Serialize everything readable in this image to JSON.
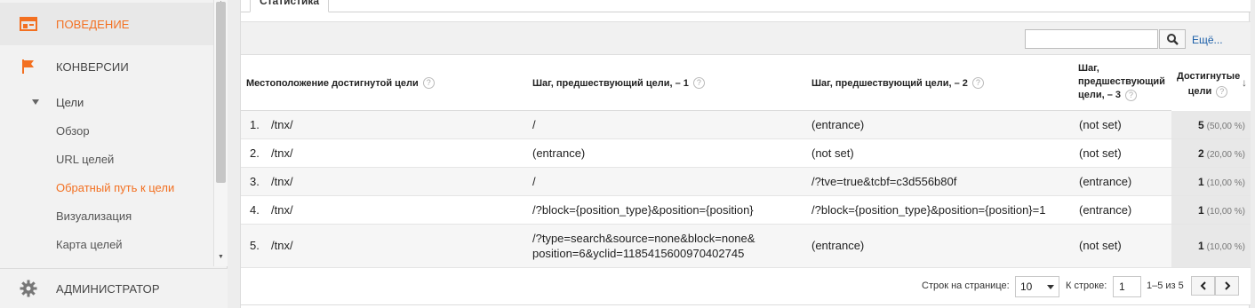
{
  "sidebar": {
    "behavior": {
      "label": "ПОВЕДЕНИЕ",
      "icon": "layout-icon"
    },
    "conversions": {
      "label": "КОНВЕРСИИ",
      "icon": "flag-icon"
    },
    "goals": {
      "label": "Цели"
    },
    "links": [
      {
        "label": "Обзор"
      },
      {
        "label": "URL целей"
      },
      {
        "label": "Обратный путь к цели"
      },
      {
        "label": "Визуализация"
      },
      {
        "label": "Карта целей"
      }
    ],
    "admin": {
      "label": "АДМИНИСТРАТОР",
      "icon": "gear-icon"
    }
  },
  "tab": {
    "label": "Статистика"
  },
  "toolbar": {
    "search_placeholder": "",
    "more_label": "Ещё..."
  },
  "table": {
    "headers": {
      "location": "Местоположение достигнутой цели",
      "step1": "Шаг, предшествующий цели, – 1",
      "step2": "Шаг, предшествующий цели, – 2",
      "step3_line1": "Шаг,",
      "step3_line2": "предшествующий",
      "step3_line3": "цели, – 3",
      "metric_line1": "Достигнутые",
      "metric_line2": "цели"
    },
    "rows": [
      {
        "num": "1.",
        "loc": "/tnx/",
        "step1": "/",
        "step2": "(entrance)",
        "step3": "(not set)",
        "goals": "5",
        "pct": "(50,00 %)"
      },
      {
        "num": "2.",
        "loc": "/tnx/",
        "step1": "(entrance)",
        "step2": "(not set)",
        "step3": "(not set)",
        "goals": "2",
        "pct": "(20,00 %)"
      },
      {
        "num": "3.",
        "loc": "/tnx/",
        "step1": "/",
        "step2": "/?tve=true&tcbf=c3d556b80f",
        "step3": "(entrance)",
        "goals": "1",
        "pct": "(10,00 %)"
      },
      {
        "num": "4.",
        "loc": "/tnx/",
        "step1": "/?block={position_type}&position={position}",
        "step2": "/?block={position_type}&position={position}=1",
        "step3": "(entrance)",
        "goals": "1",
        "pct": "(10,00 %)"
      },
      {
        "num": "5.",
        "loc": "/tnx/",
        "step1_line1": "/?type=search&source=none&block=none&",
        "step1_line2": "position=6&yclid=1185415600970402745",
        "step2": "(entrance)",
        "step3": "(not set)",
        "goals": "1",
        "pct": "(10,00 %)"
      }
    ]
  },
  "footer": {
    "rows_label": "Строк на странице:",
    "rows_value": "10",
    "goto_label": "К строке:",
    "goto_value": "1",
    "range_label": "1–5 из 5"
  },
  "colors": {
    "accent": "#f37021",
    "link": "#1a5ea8"
  }
}
